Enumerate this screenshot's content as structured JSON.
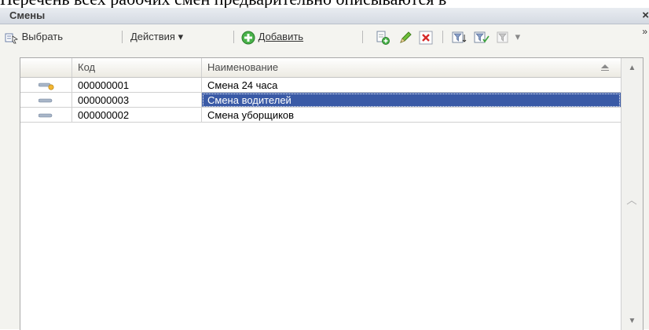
{
  "document_text": "Перечень всех рабочих смен предварительно описываются в",
  "window": {
    "title": "Смены",
    "close_symbol": "×"
  },
  "toolbar": {
    "select_label": "Выбрать",
    "actions_label": "Действия",
    "add_label": "Добавить",
    "dropdown_symbol": "▾",
    "more_symbol": "»"
  },
  "table": {
    "columns": [
      "",
      "Код",
      "Наименование"
    ],
    "rows": [
      {
        "icon": "folder-item-icon",
        "code": "000000001",
        "name": "Смена 24 часа",
        "selected": false
      },
      {
        "icon": "item-icon",
        "code": "000000003",
        "name": "Смена водителей",
        "selected": true
      },
      {
        "icon": "item-icon",
        "code": "000000002",
        "name": "Смена уборщиков",
        "selected": false
      }
    ]
  },
  "colors": {
    "selection": "#3a5aa6",
    "add_icon": "#3aa23a",
    "delete_icon": "#d62a2a"
  }
}
